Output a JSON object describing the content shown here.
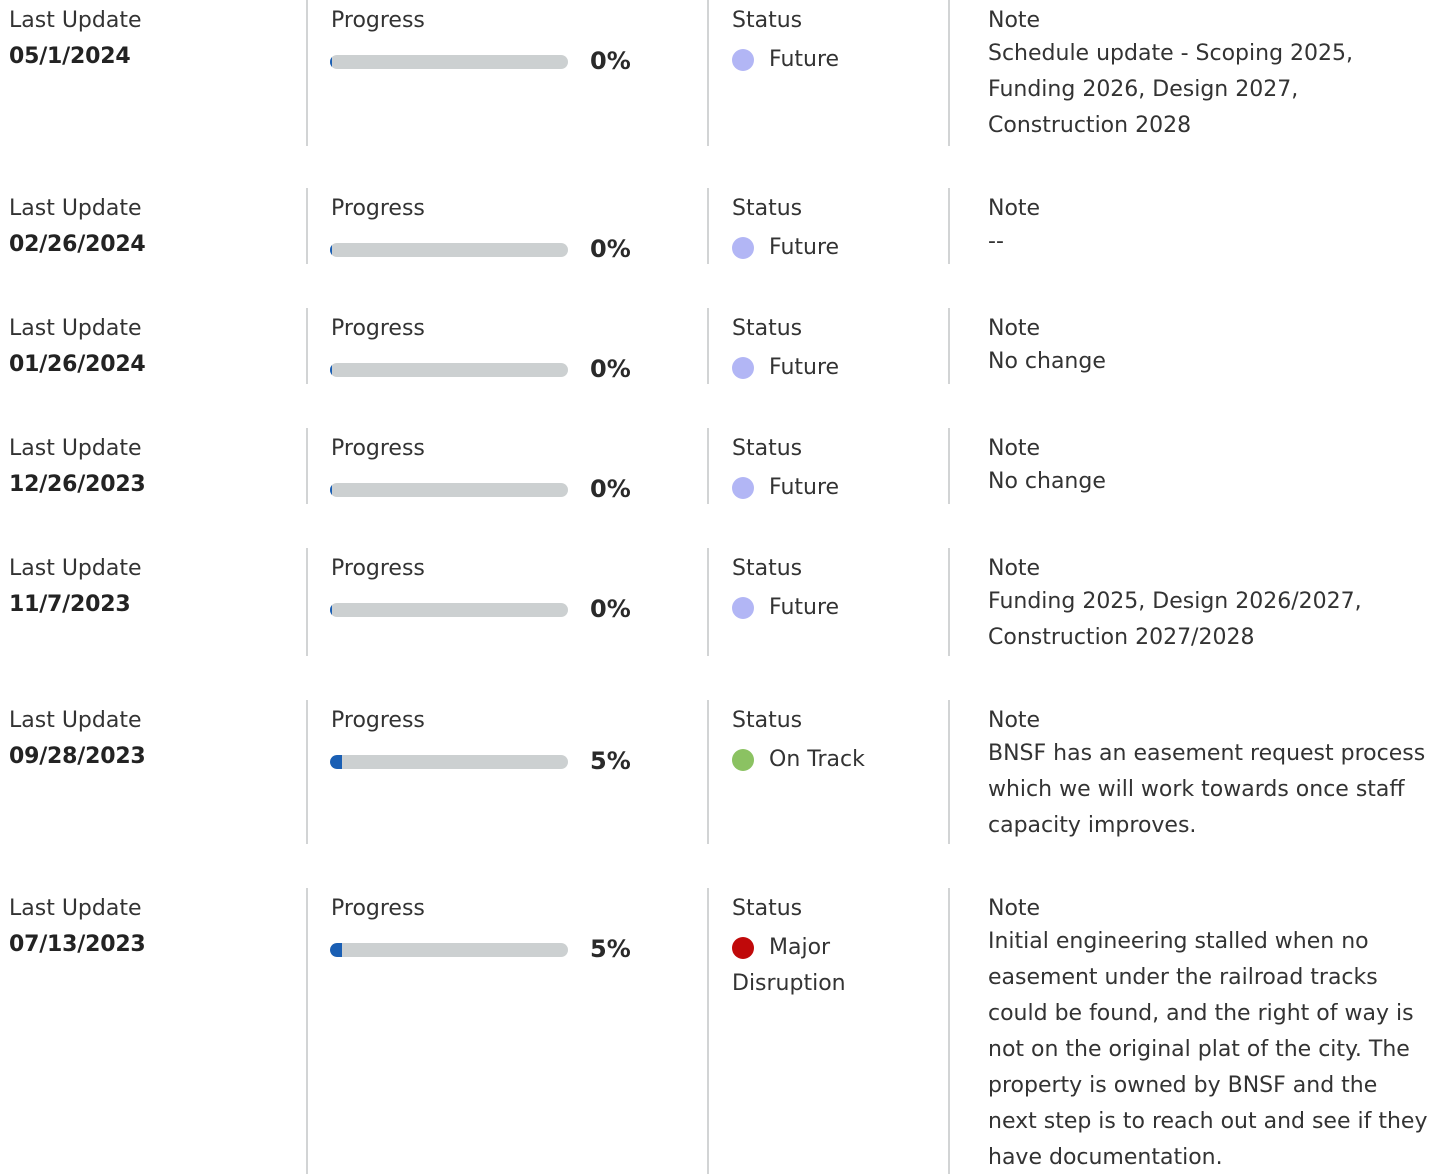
{
  "labels": {
    "last_update": "Last Update",
    "progress": "Progress",
    "status": "Status",
    "note": "Note"
  },
  "colors": {
    "future": "#b2b6f5",
    "on_track": "#8bc262",
    "major_disruption": "#c0090a",
    "progress_fill": "#1a5fb4",
    "progress_track": "#ccd0d1"
  },
  "entries": [
    {
      "date": "05/1/2024",
      "progress": 0,
      "progress_label": "0%",
      "status": "Future",
      "status_color": "#b2b6f5",
      "note": "Schedule update - Scoping 2025, Funding 2026, Design 2027, Construction 2028"
    },
    {
      "date": "02/26/2024",
      "progress": 0,
      "progress_label": "0%",
      "status": "Future",
      "status_color": "#b2b6f5",
      "note": "--"
    },
    {
      "date": "01/26/2024",
      "progress": 0,
      "progress_label": "0%",
      "status": "Future",
      "status_color": "#b2b6f5",
      "note": "No change"
    },
    {
      "date": "12/26/2023",
      "progress": 0,
      "progress_label": "0%",
      "status": "Future",
      "status_color": "#b2b6f5",
      "note": "No change"
    },
    {
      "date": "11/7/2023",
      "progress": 0,
      "progress_label": "0%",
      "status": "Future",
      "status_color": "#b2b6f5",
      "note": "Funding 2025, Design 2026/2027, Construction 2027/2028"
    },
    {
      "date": "09/28/2023",
      "progress": 5,
      "progress_label": "5%",
      "status": "On Track",
      "status_color": "#8bc262",
      "note": "BNSF has an easement request process which we will work towards once staff capacity improves."
    },
    {
      "date": "07/13/2023",
      "progress": 5,
      "progress_label": "5%",
      "status": "Major Disruption",
      "status_color": "#c0090a",
      "note": "Initial engineering stalled when no easement under the railroad tracks could be found, and the right of way is not on the original plat of the city. The property is owned by BNSF and the next step is to reach out and see if they have documentation."
    }
  ]
}
